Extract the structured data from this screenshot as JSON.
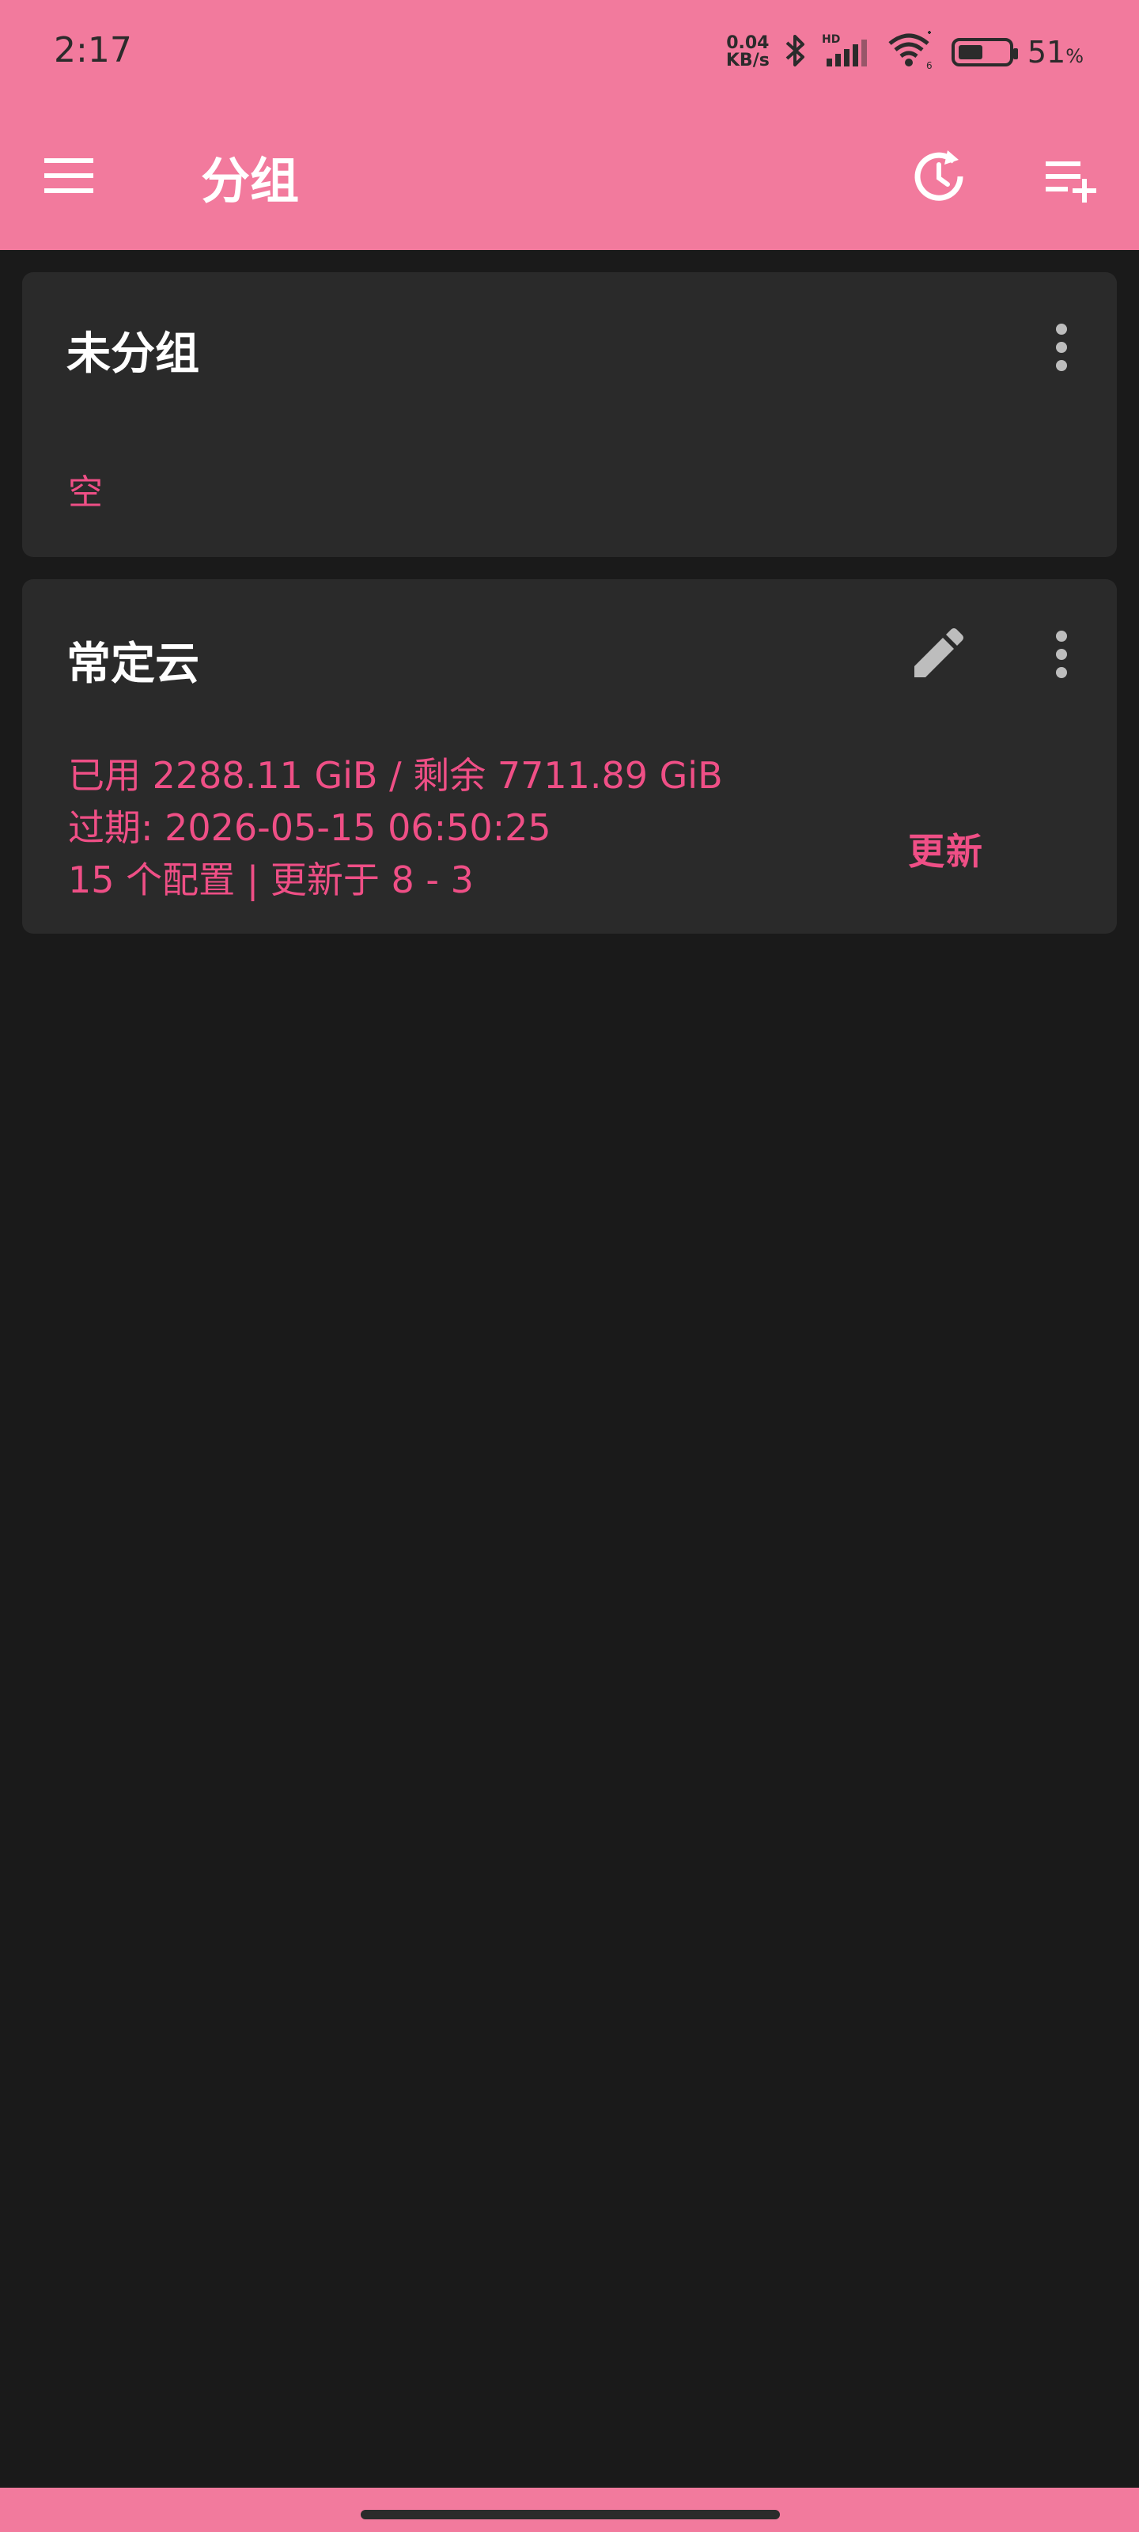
{
  "status_bar": {
    "time": "2:17",
    "net_speed_value": "0.04",
    "net_speed_unit": "KB/s",
    "battery_percent": "51",
    "battery_unit": "%",
    "icons": [
      "bluetooth-icon",
      "hd-signal-icon",
      "wifi-icon",
      "battery-icon"
    ]
  },
  "app_bar": {
    "title": "分组",
    "icons": [
      "menu-icon",
      "history-icon",
      "add-list-icon"
    ]
  },
  "groups": [
    {
      "name": "未分组",
      "empty_label": "空"
    },
    {
      "name": "常定云",
      "usage": "已用 2288.11 GiB / 剩余 7711.89 GiB",
      "expiry": "过期: 2026-05-15 06:50:25",
      "summary": "15 个配置 | 更新于 8 - 3",
      "update_label": "更新"
    }
  ],
  "colors": {
    "accent": "#f27a9d",
    "highlight_text": "#ef4f86",
    "background": "#1a1a1a",
    "card": "#2a2a2a"
  }
}
